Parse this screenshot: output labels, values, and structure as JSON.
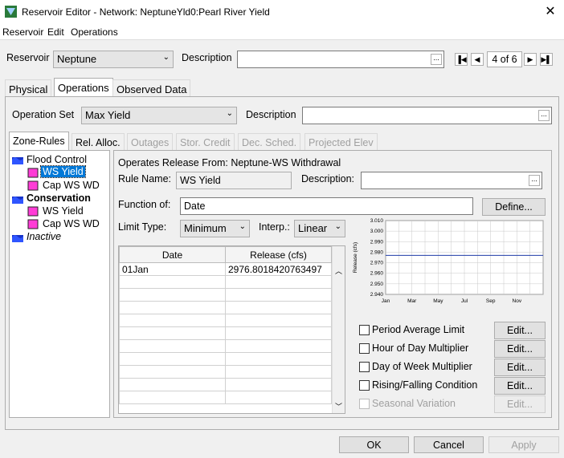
{
  "window": {
    "title": "Reservoir Editor - Network: NeptuneYld0:Pearl River Yield"
  },
  "menu": {
    "items": [
      "Reservoir",
      "Edit",
      "Operations"
    ]
  },
  "header": {
    "reservoir_label": "Reservoir",
    "reservoir_value": "Neptune",
    "description_label": "Description",
    "description_value": "",
    "nav_text": "4 of 6"
  },
  "main_tabs": [
    "Physical",
    "Operations",
    "Observed Data"
  ],
  "operations": {
    "op_set_label": "Operation Set",
    "op_set_value": "Max Yield",
    "description_label": "Description",
    "description_value": ""
  },
  "sub_tabs": [
    "Zone-Rules",
    "Rel. Alloc.",
    "Outages",
    "Stor. Credit",
    "Dec. Sched.",
    "Projected Elev"
  ],
  "tree": {
    "zone1": "Flood Control",
    "zone1_rule1": "WS Yield",
    "zone1_rule2": "Cap WS WD",
    "zone2": "Conservation",
    "zone2_rule1": "WS Yield",
    "zone2_rule2": "Cap WS WD",
    "zone3": "Inactive"
  },
  "rule": {
    "operates_from": "Operates Release From: Neptune-WS Withdrawal",
    "rule_name_label": "Rule Name:",
    "rule_name_value": "WS Yield",
    "description_label": "Description:",
    "description_value": "",
    "function_label": "Function of:",
    "function_value": "Date",
    "define_label": "Define...",
    "limit_type_label": "Limit Type:",
    "limit_type_value": "Minimum",
    "interp_label": "Interp.:",
    "interp_value": "Linear"
  },
  "table": {
    "col_date": "Date",
    "col_release": "Release (cfs)",
    "row1_date": "01Jan",
    "row1_release": "2976.8018420763497"
  },
  "chart_data": {
    "type": "line",
    "title": "",
    "xlabel": "",
    "ylabel": "Release (cfs)",
    "ylim": [
      2.94,
      3.01
    ],
    "yticks": [
      "3.010",
      "3.000",
      "2.990",
      "2.980",
      "2.970",
      "2.960",
      "2.950",
      "2.940"
    ],
    "xticks": [
      "Jan",
      "Mar",
      "May",
      "Jul",
      "Sep",
      "Nov"
    ],
    "y_line_value": 2.977,
    "grid": true,
    "line_color": "#1f3ca8"
  },
  "options": {
    "period_avg": "Period Average Limit",
    "hour_of_day": "Hour of Day Multiplier",
    "day_of_week": "Day of Week Multiplier",
    "rising_falling": "Rising/Falling Condition",
    "seasonal": "Seasonal Variation",
    "edit_label": "Edit..."
  },
  "footer": {
    "ok": "OK",
    "cancel": "Cancel",
    "apply": "Apply"
  }
}
